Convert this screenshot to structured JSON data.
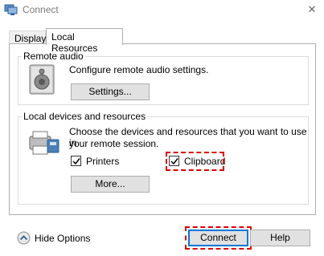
{
  "window": {
    "title": "Connect",
    "close_glyph": "✕"
  },
  "tabs": [
    {
      "label": "Display",
      "active": false
    },
    {
      "label": "Local Resources",
      "active": true
    }
  ],
  "remote_audio": {
    "group_label": "Remote audio",
    "description": "Configure remote audio settings.",
    "settings_button": "Settings..."
  },
  "local_devices": {
    "group_label": "Local devices and resources",
    "description_line1": "Choose the devices and resources that you want to use in",
    "description_line2": "your remote session.",
    "printers": {
      "label": "Printers",
      "checked": true
    },
    "clipboard": {
      "label": "Clipboard",
      "checked": true
    },
    "more_button": "More..."
  },
  "footer": {
    "hide_options": "Hide Options",
    "connect_button": "Connect",
    "help_button": "Help"
  },
  "colors": {
    "highlight": "#e00000",
    "accent": "#0078d7"
  }
}
